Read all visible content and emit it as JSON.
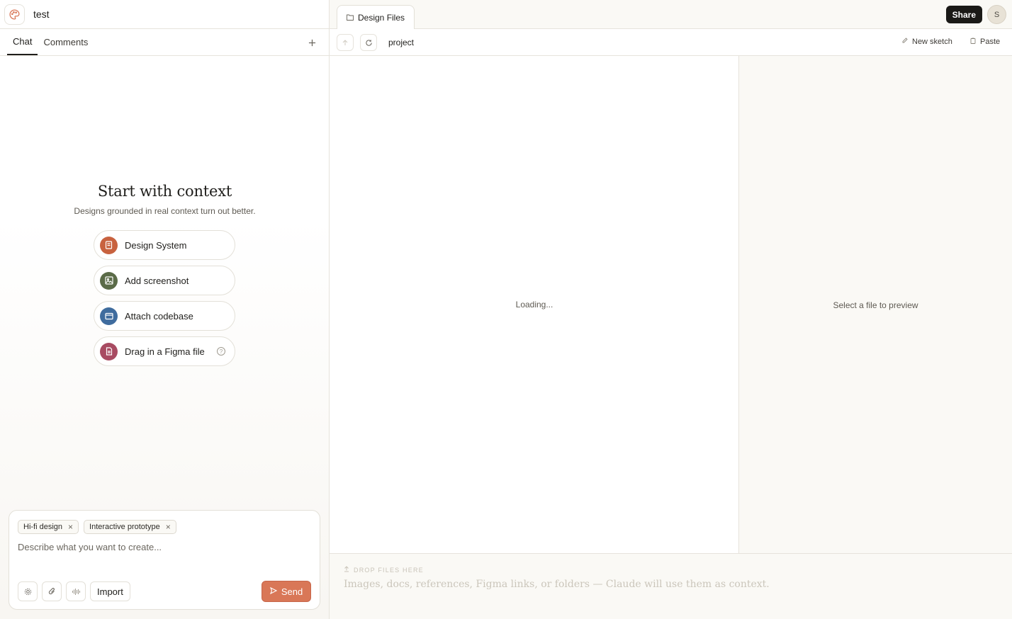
{
  "project": {
    "name": "test"
  },
  "left_tabs": {
    "chat": "Chat",
    "comments": "Comments"
  },
  "context": {
    "title": "Start with context",
    "subtitle": "Designs grounded in real context turn out better.",
    "options": [
      {
        "label": "Design System",
        "icon": "book-icon",
        "color": "#c8623f"
      },
      {
        "label": "Add screenshot",
        "icon": "image-icon",
        "color": "#5b6b48"
      },
      {
        "label": "Attach codebase",
        "icon": "folder-icon",
        "color": "#3f6c9e"
      },
      {
        "label": "Drag in a Figma file",
        "icon": "figma-file-icon",
        "color": "#a84b62"
      }
    ]
  },
  "composer": {
    "chips": [
      "Hi-fi design",
      "Interactive prototype"
    ],
    "placeholder": "Describe what you want to create...",
    "import_label": "Import",
    "send_label": "Send"
  },
  "right_header": {
    "tab_label": "Design Files",
    "share_label": "Share",
    "avatar_initial": "S"
  },
  "toolbar": {
    "breadcrumb": "project",
    "new_sketch": "New sketch",
    "paste": "Paste"
  },
  "files": {
    "loading": "Loading..."
  },
  "preview": {
    "empty": "Select a file to preview"
  },
  "drop": {
    "title": "DROP FILES HERE",
    "description": "Images, docs, references, Figma links, or folders — Claude will use them as context."
  },
  "colors": {
    "accent": "#d97757",
    "share_bg": "#1a1916"
  }
}
